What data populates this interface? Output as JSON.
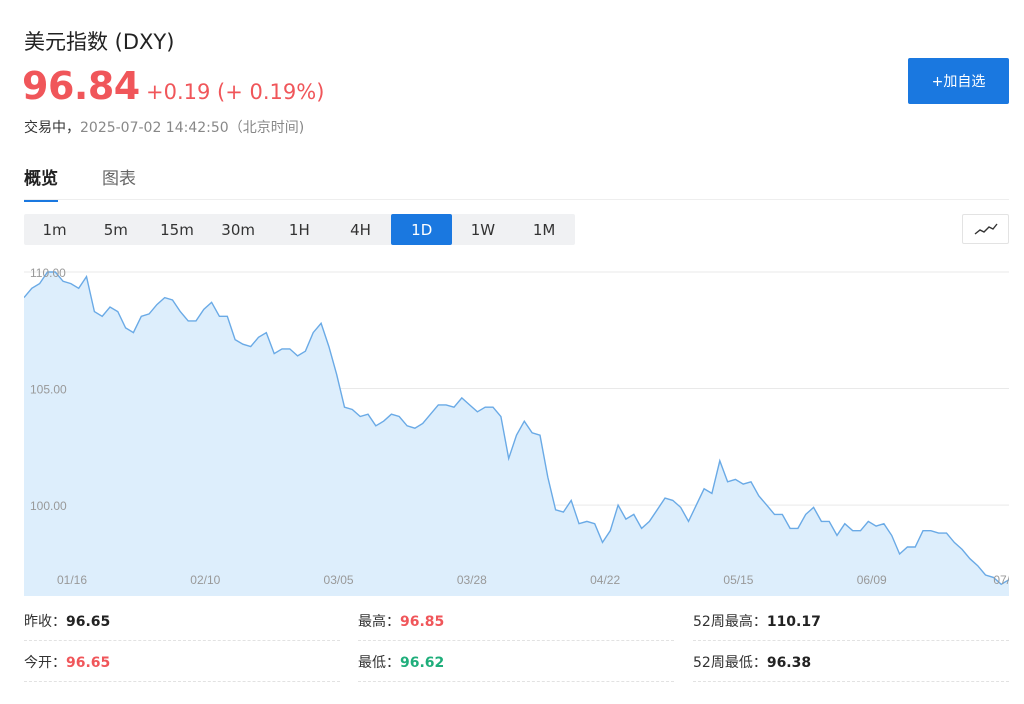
{
  "header": {
    "title": "美元指数 (DXY)",
    "price": "96.84",
    "change": "+0.19 (+ 0.19%)",
    "status": "交易中，",
    "timestamp": "2025-07-02 14:42:50（北京时间)"
  },
  "add_watchlist_label": "+加自选",
  "tabs": [
    {
      "label": "概览",
      "active": true
    },
    {
      "label": "图表",
      "active": false
    }
  ],
  "periods": [
    {
      "label": "1m"
    },
    {
      "label": "5m"
    },
    {
      "label": "15m"
    },
    {
      "label": "30m"
    },
    {
      "label": "1H"
    },
    {
      "label": "4H"
    },
    {
      "label": "1D",
      "active": true
    },
    {
      "label": "1W"
    },
    {
      "label": "1M"
    }
  ],
  "chart_type_icon": "line-chart-icon",
  "colors": {
    "up": "#f0565a",
    "down": "#1fae7b",
    "accent": "#1a78e0",
    "chart_line": "#6aaae6",
    "chart_fill": "#ddeefc"
  },
  "chart_data": {
    "type": "area",
    "y_ticks": [
      "110.00",
      "105.00",
      "100.00"
    ],
    "x_ticks": [
      "01/16",
      "02/10",
      "03/05",
      "03/28",
      "04/22",
      "05/15",
      "06/09",
      "07/0"
    ],
    "ylim": [
      96.1,
      110.6
    ],
    "grid": true,
    "series": [
      {
        "values": [
          108.9,
          109.3,
          109.5,
          110.0,
          110.0,
          109.6,
          109.5,
          109.3,
          109.8,
          108.3,
          108.1,
          108.5,
          108.3,
          107.6,
          107.4,
          108.1,
          108.2,
          108.6,
          108.9,
          108.8,
          108.3,
          107.9,
          107.9,
          108.4,
          108.7,
          108.1,
          108.1,
          107.1,
          106.9,
          106.8,
          107.2,
          107.4,
          106.5,
          106.7,
          106.7,
          106.4,
          106.6,
          107.4,
          107.8,
          106.8,
          105.6,
          104.2,
          104.1,
          103.8,
          103.9,
          103.4,
          103.6,
          103.9,
          103.8,
          103.4,
          103.3,
          103.5,
          103.9,
          104.3,
          104.3,
          104.2,
          104.6,
          104.3,
          104.0,
          104.2,
          104.2,
          103.8,
          102.0,
          103.0,
          103.6,
          103.1,
          103.0,
          101.2,
          99.8,
          99.7,
          100.2,
          99.2,
          99.3,
          99.2,
          98.4,
          98.9,
          100.0,
          99.4,
          99.6,
          99.0,
          99.3,
          99.8,
          100.3,
          100.2,
          99.9,
          99.3,
          100.0,
          100.7,
          100.5,
          101.9,
          101.0,
          101.1,
          100.9,
          101.0,
          100.4,
          100.0,
          99.6,
          99.6,
          99.0,
          99.0,
          99.6,
          99.9,
          99.3,
          99.3,
          98.7,
          99.2,
          98.9,
          98.9,
          99.3,
          99.1,
          99.2,
          98.7,
          97.9,
          98.2,
          98.2,
          98.9,
          98.9,
          98.8,
          98.8,
          98.4,
          98.1,
          97.7,
          97.4,
          97.0,
          96.9,
          96.6,
          96.8
        ]
      }
    ]
  },
  "stats": [
    {
      "label": "昨收：",
      "value": "96.65",
      "color": "dark"
    },
    {
      "label": "最高：",
      "value": "96.85",
      "color": "red"
    },
    {
      "label": "52周最高：",
      "value": "110.17",
      "color": "dark"
    },
    {
      "label": "今开：",
      "value": "96.65",
      "color": "red"
    },
    {
      "label": "最低：",
      "value": "96.62",
      "color": "green"
    },
    {
      "label": "52周最低：",
      "value": "96.38",
      "color": "dark"
    }
  ]
}
